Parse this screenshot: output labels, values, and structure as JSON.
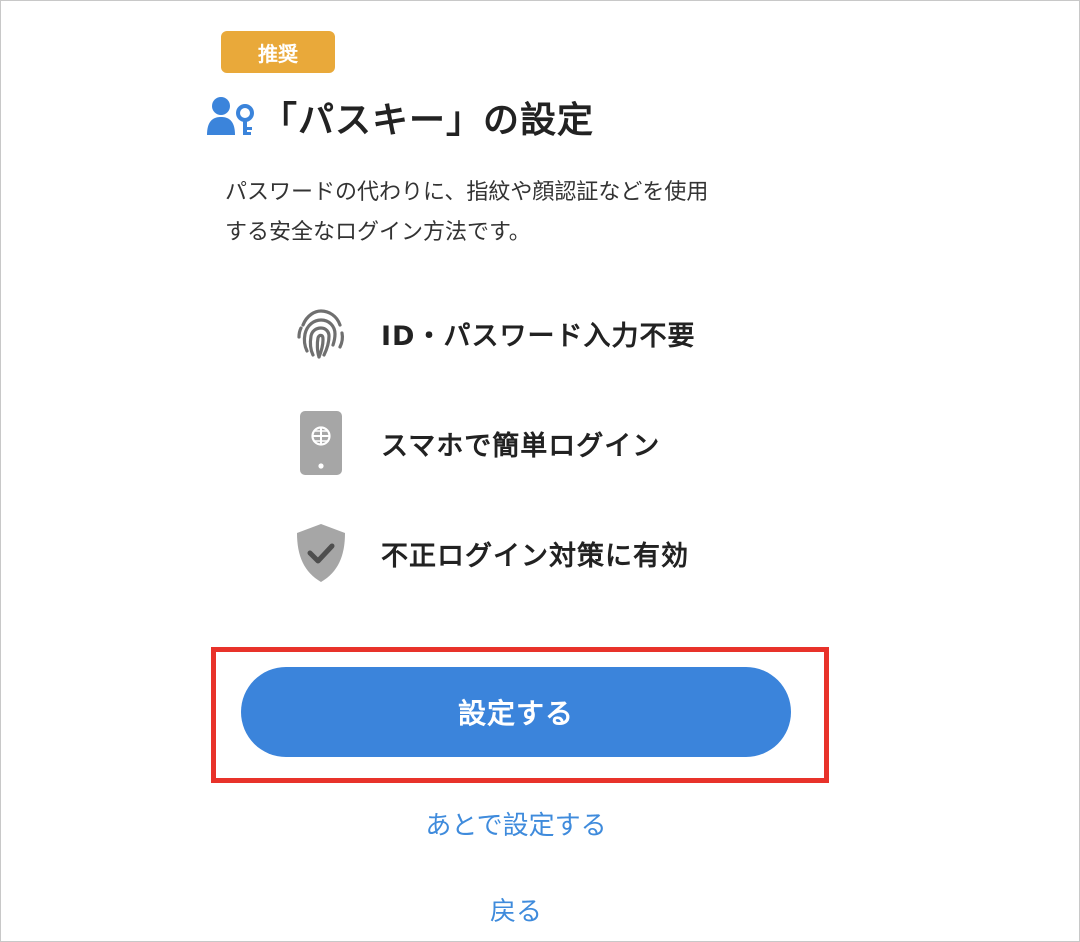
{
  "badge": {
    "label": "推奨",
    "color": "#e9a93a"
  },
  "header": {
    "title": "「パスキー」の設定",
    "icon": "user-key-icon"
  },
  "description": {
    "line1": "パスワードの代わりに、指紋や顔認証などを使用",
    "line2": "する安全なログイン方法です。"
  },
  "features": [
    {
      "icon": "fingerprint-icon",
      "label": "ID・パスワード入力不要"
    },
    {
      "icon": "smartphone-icon",
      "label": "スマホで簡単ログイン"
    },
    {
      "icon": "shield-check-icon",
      "label": "不正ログイン対策に有効"
    }
  ],
  "actions": {
    "primary_label": "設定する",
    "later_label": "あとで設定する",
    "back_label": "戻る"
  },
  "colors": {
    "primary": "#3b84db",
    "link": "#3f8bdc",
    "highlight": "#e8322a"
  }
}
